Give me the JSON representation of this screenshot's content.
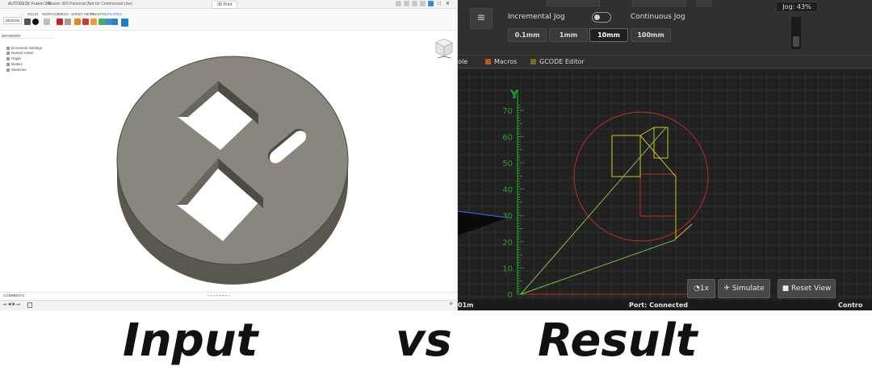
{
  "cad": {
    "app_title": "AUTODESK Fusion 360",
    "file_title": "Fusion 360 Personal (Not for Commercial Use)",
    "document_tab": "3D Print",
    "workspace": "DESIGN",
    "ribbon_tabs": [
      "SOLID",
      "SURFACE",
      "MESH",
      "SHEET METAL",
      "PLASTIC",
      "UTILITIES"
    ],
    "browser_title": "BROWSER",
    "browser_items": [
      "Document Settings",
      "Named Views",
      "Origin",
      "Bodies",
      "Sketches"
    ],
    "comments_label": "COMMENTS",
    "colors": {
      "part_top": "#8b877f",
      "part_side": "#5a564e",
      "accent": "#1d7cd2"
    }
  },
  "cnc": {
    "incremental_jog_label": "Incremental Jog",
    "continuous_jog_label": "Continuous Jog",
    "jog_steps": [
      "0.1mm",
      "1mm",
      "10mm",
      "100mm"
    ],
    "active_step": "10mm",
    "jog_readout": "Jog: 43%",
    "jog_percent": 43,
    "tabs": [
      "sole",
      "Macros",
      "GCODE Editor"
    ],
    "buttons": {
      "speed": "1x",
      "simulate": "Simulate",
      "reset_view": "Reset View"
    },
    "status": {
      "left": "01m",
      "port": "Port: Connected",
      "right": "Contro"
    },
    "axis_label": "Y",
    "y_ticks": [
      0,
      10,
      20,
      30,
      40,
      50,
      60,
      70
    ],
    "colors": {
      "grid": "#2e2e2e",
      "axis": "#1fa31f",
      "boundary": "#c62828",
      "toolpath_rapid": "#7bc043",
      "toolpath_feed": "#d4c21a"
    }
  },
  "captions": {
    "input": "Input",
    "vs": "vs",
    "result": "Result"
  }
}
